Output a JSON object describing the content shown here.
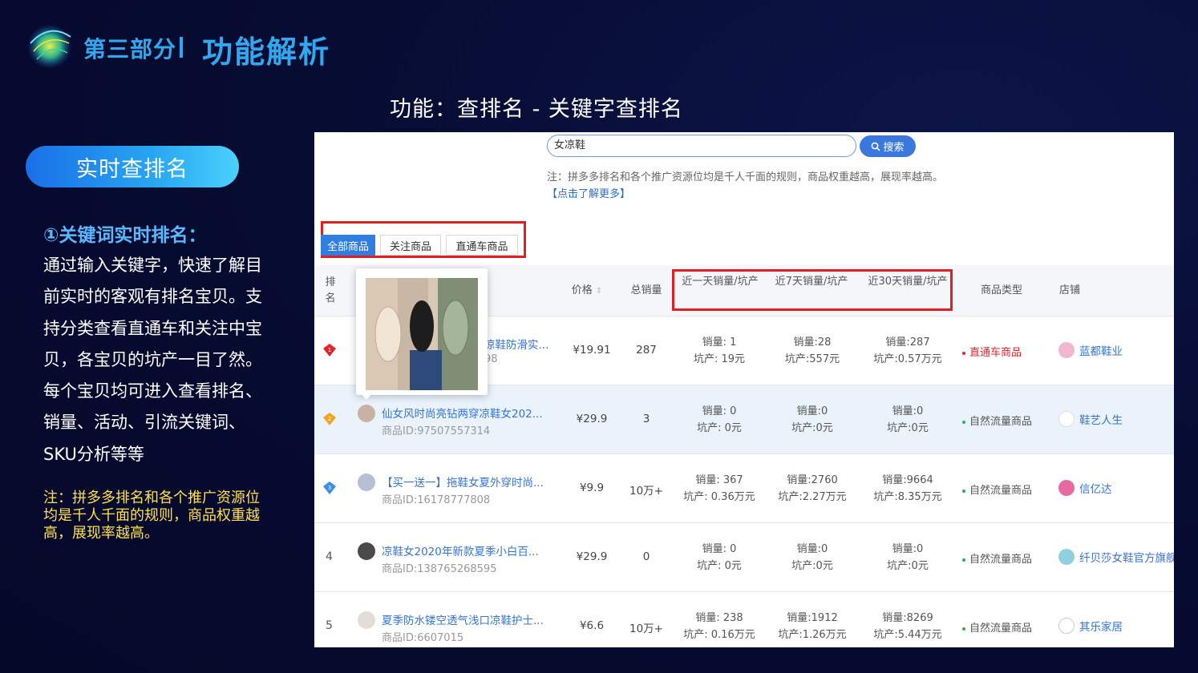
{
  "header": {
    "section": "第三部分",
    "title": "功能解析",
    "feature": "功能：查排名 - 关键字查排名"
  },
  "sidebar": {
    "pill": "实时查排名",
    "heading": "①关键词实时排名：",
    "description": "通过输入关键字，快速了解目前实时的客观有排名宝贝。支持分类查看直通车和关注中宝贝，各宝贝的坑产一目了然。每个宝贝均可进入查看排名、销量、活动、引流关键词、SKU分析等等",
    "note": "注：拼多多排名和各个推广资源位均是千人千面的规则，商品权重越高，展现率越高。"
  },
  "panel": {
    "search_value": "女凉鞋",
    "search_button": "搜索",
    "note": "注：拼多多排名和各个推广资源位均是千人千面的规则，商品权重越高，展现率越高。",
    "note_link": "【点击了解更多】",
    "tabs": [
      "全部商品",
      "关注商品",
      "直通车商品"
    ],
    "headers": {
      "rank": "排名",
      "price": "价格",
      "total": "总销量",
      "day1": "近一天销量/坑产",
      "day7": "近7天销量/坑产",
      "day30": "近30天销量/坑产",
      "type": "商品类型",
      "store": "店铺"
    },
    "rows": [
      {
        "rank": "",
        "badge": "red",
        "name": "凉鞋防滑实...",
        "id": "98",
        "price": "¥19.91",
        "total": "287",
        "d1_sales": "销量: 1",
        "d1_gmv": "坑产: 19元",
        "d7_sales": "销量:28",
        "d7_gmv": "坑产:557元",
        "d30_sales": "销量:287",
        "d30_gmv": "坑产:0.57万元",
        "type": "直通车商品",
        "type_color": "#e0262a",
        "store": "蓝都鞋业"
      },
      {
        "rank": "",
        "badge": "gold",
        "name": "仙女风时尚亮钻两穿凉鞋女202...",
        "id": "商品ID:97507557314",
        "price": "¥29.9",
        "total": "3",
        "d1_sales": "销量: 0",
        "d1_gmv": "坑产: 0元",
        "d7_sales": "销量:0",
        "d7_gmv": "坑产:0元",
        "d30_sales": "销量:0",
        "d30_gmv": "坑产:0元",
        "type": "自然流量商品",
        "type_color": "#2bb24c",
        "store": "鞋艺人生"
      },
      {
        "rank": "",
        "badge": "blue",
        "name": "【买一送一】拖鞋女夏外穿时尚...",
        "id": "商品ID:16178777808",
        "price": "¥9.9",
        "total": "10万+",
        "d1_sales": "销量: 367",
        "d1_gmv": "坑产: 0.36万元",
        "d7_sales": "销量:2760",
        "d7_gmv": "坑产:2.27万元",
        "d30_sales": "销量:9664",
        "d30_gmv": "坑产:8.35万元",
        "type": "自然流量商品",
        "type_color": "#2bb24c",
        "store": "信亿达"
      },
      {
        "rank": "4",
        "badge": "",
        "name": "凉鞋女2020年新款夏季小白百...",
        "id": "商品ID:138765268595",
        "price": "¥29.9",
        "total": "0",
        "d1_sales": "销量: 0",
        "d1_gmv": "坑产: 0元",
        "d7_sales": "销量:0",
        "d7_gmv": "坑产:0元",
        "d30_sales": "销量:0",
        "d30_gmv": "坑产:0元",
        "type": "自然流量商品",
        "type_color": "#2bb24c",
        "store": "纤贝莎女鞋官方旗舰"
      },
      {
        "rank": "5",
        "badge": "",
        "name": "夏季防水镂空透气浅口凉鞋护士...",
        "id": "商品ID:6607015",
        "price": "¥6.6",
        "total": "10万+",
        "d1_sales": "销量: 238",
        "d1_gmv": "坑产: 0.16万元",
        "d7_sales": "销量:1912",
        "d7_gmv": "坑产:1.26万元",
        "d30_sales": "销量:8269",
        "d30_gmv": "坑产:5.44万元",
        "type": "自然流量商品",
        "type_color": "#2bb24c",
        "store": "其乐家居"
      }
    ]
  }
}
